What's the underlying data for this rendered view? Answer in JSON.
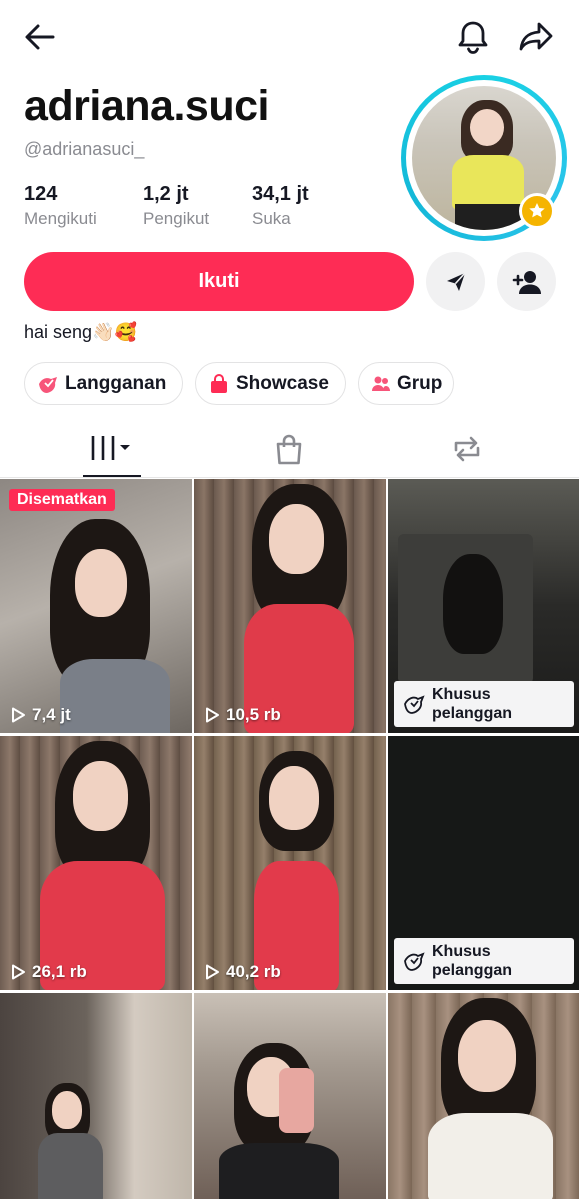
{
  "profile": {
    "username": "adriana.suci",
    "handle": "@adrianasuci_",
    "stats": [
      {
        "value": "124",
        "label": "Mengikuti"
      },
      {
        "value": "1,2 jt",
        "label": "Pengikut"
      },
      {
        "value": "34,1 jt",
        "label": "Suka"
      }
    ],
    "bio": "hai seng👋🏻🥰",
    "follow_label": "Ikuti"
  },
  "chips": [
    {
      "label": "Langganan",
      "icon": "subscription-icon"
    },
    {
      "label": "Showcase",
      "icon": "shopping-bag-icon"
    },
    {
      "label": "Grup",
      "icon": "group-icon"
    }
  ],
  "tabs": [
    {
      "name": "videos",
      "icon": "grid-icon",
      "active": true
    },
    {
      "name": "shop",
      "icon": "shopping-bag-icon",
      "active": false
    },
    {
      "name": "reposts",
      "icon": "repost-icon",
      "active": false
    }
  ],
  "videos": [
    {
      "pinned_label": "Disematkan",
      "views": "7,4 jt"
    },
    {
      "views": "10,5 rb"
    },
    {
      "subscriber_label": "Khusus pelanggan"
    },
    {
      "views": "26,1 rb"
    },
    {
      "views": "40,2 rb"
    },
    {
      "subscriber_label": "Khusus pelanggan"
    },
    {},
    {},
    {}
  ],
  "colors": {
    "accent": "#fe2c55",
    "avatar_ring": "#19d1e4",
    "badge": "#f5b400",
    "text": "#161823",
    "muted": "#8a8b91"
  }
}
